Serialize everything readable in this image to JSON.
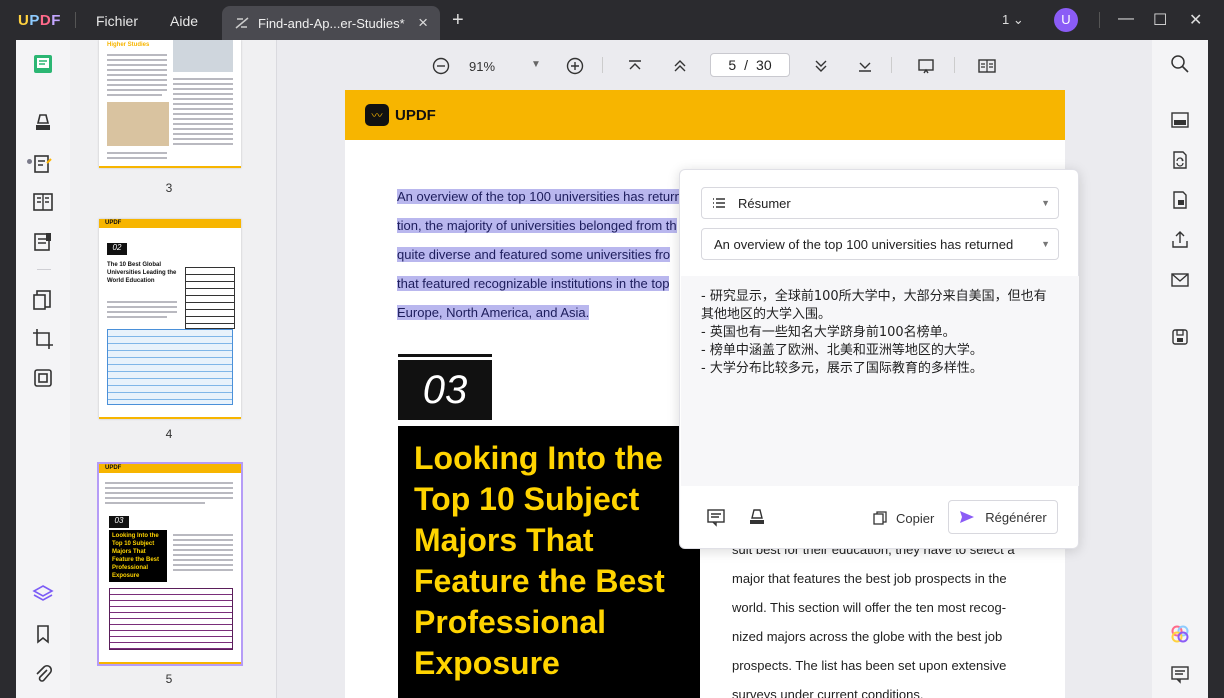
{
  "app": {
    "logo": "UPDF",
    "menus": [
      "Fichier",
      "Aide"
    ],
    "tab_title": "Find-and-Ap...er-Studies*",
    "window_count": "1",
    "avatar_letter": "U",
    "accent": "#8b5cf6"
  },
  "toolbar": {
    "zoom": "91%",
    "current_page": "5",
    "page_separator": "/",
    "total_pages": "30"
  },
  "thumbnails": [
    {
      "label": "3",
      "heading": "Higher Studies"
    },
    {
      "label": "4",
      "section": "02",
      "title": "The 10 Best Global Universities Leading the World Education"
    },
    {
      "label": "5",
      "section": "03",
      "title": "Looking Into the Top 10 Subject Majors That Feature the Best Professional Exposure"
    }
  ],
  "page": {
    "logo_text": "UPDF",
    "highlight_lines": [
      "An overview of the top 100 universities has return",
      "tion, the majority of universities belonged from th",
      "quite diverse and featured some universities fro",
      "that featured recognizable institutions in the top",
      "Europe, North America, and Asia."
    ],
    "section_number": "03",
    "section_title": "Looking Into the Top 10 Subject Majors That Feature the Best Professional Exposure",
    "body_lines": [
      "suit best for their education, they have to select a",
      "major that features the best job prospects in the",
      "world. This section will offer the ten most recog-",
      "nized majors across the globe with the best job",
      "prospects. The list has been set upon extensive",
      "surveys under current conditions."
    ]
  },
  "ai_panel": {
    "mode": "Résumer",
    "source_text": "An overview of the top 100 universities has returned",
    "result_lines": [
      "- 研究显示，全球前100所大学中，大部分来自美国，但也有其他地区的大学入围。",
      "- 英国也有一些知名大学跻身前100名榜单。",
      "- 榜单中涵盖了欧洲、北美和亚洲等地区的大学。",
      "- 大学分布比较多元，展示了国际教育的多样性。"
    ],
    "copy_label": "Copier",
    "regenerate_label": "Régénérer"
  }
}
